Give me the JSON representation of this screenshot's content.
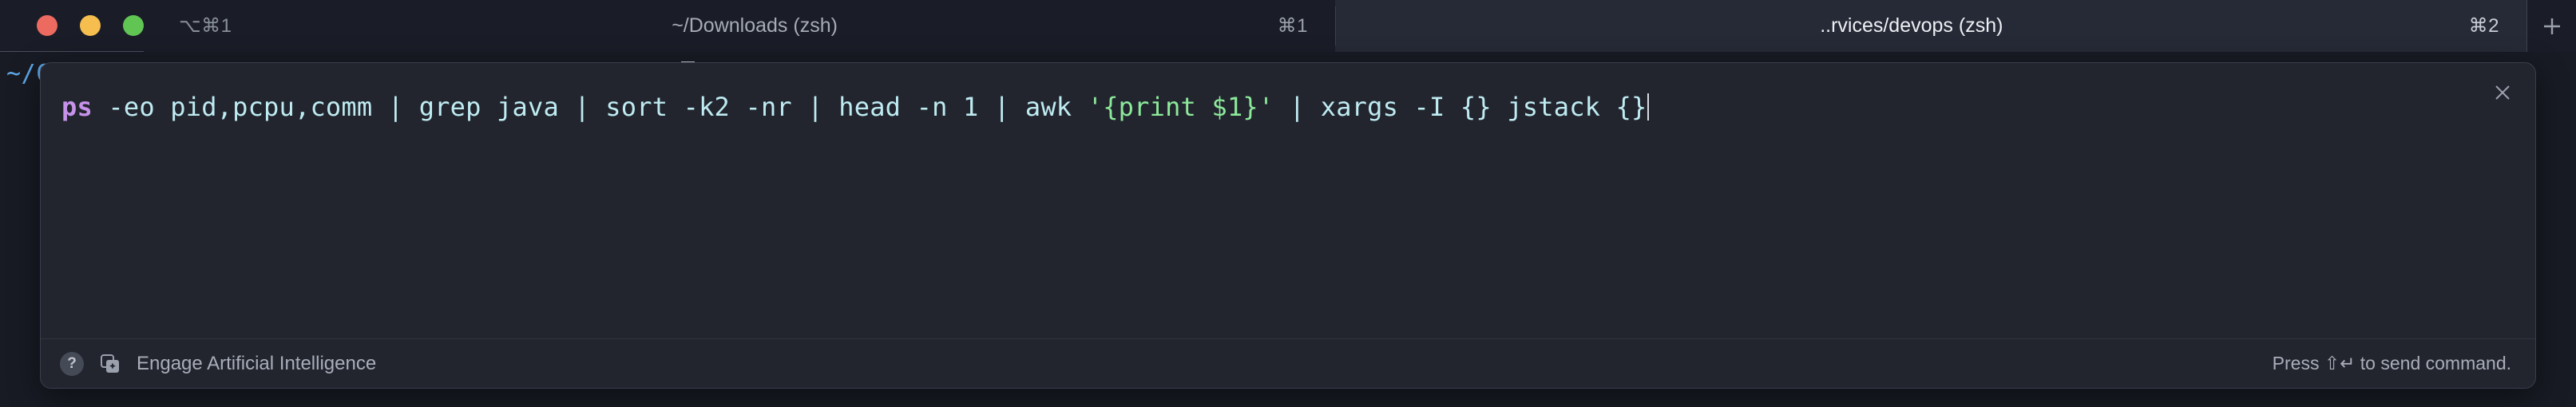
{
  "window": {
    "traffic_lights": [
      {
        "name": "close",
        "color": "#EC6A5F"
      },
      {
        "name": "minimize",
        "color": "#F5BE4F"
      },
      {
        "name": "maximize",
        "color": "#61C554"
      }
    ],
    "window_shortcut": "⌥⌘1"
  },
  "tabs": [
    {
      "title": "~/Downloads (zsh)",
      "shortcut": "⌘1",
      "active": false
    },
    {
      "title": "..rvices/devops (zsh)",
      "shortcut": "⌘2",
      "active": true
    }
  ],
  "new_tab": {
    "label": "+",
    "icon": "plus-icon"
  },
  "terminal": {
    "prompt_path": "~/Code/Dev…/Engine/services/devops on main",
    "prompt_arrow": "❯"
  },
  "overlay": {
    "close_icon": "close-icon",
    "command_text": "ps -eo pid,pcpu,comm | grep java | sort -k2 -nr | head -n 1 | awk '{print $1}' | xargs -I {} jstack {}",
    "command_tokens": [
      {
        "text": "ps",
        "type": "command"
      },
      {
        "text": " -eo pid,pcpu,comm | grep java | sort -k2 -nr | head -n 1 | awk ",
        "type": "text"
      },
      {
        "text": "'{print $1}'",
        "type": "string"
      },
      {
        "text": " | xargs -I {} jstack {}",
        "type": "text"
      }
    ],
    "footer": {
      "help_label": "?",
      "ai_icon": "ai-sparkle-icon",
      "ai_label": "Engage Artificial Intelligence",
      "hint": "Press ⇧↵ to send command."
    }
  },
  "colors": {
    "background": "#181B24",
    "tabbar_inactive": "#1A1D27",
    "tabbar_active": "#262A36",
    "overlay_bg": "#22252E",
    "accent_command": "#C792EA",
    "accent_string": "#8CE99A",
    "accent_text": "#BFEBF2",
    "prompt_blue": "#5FA8E8"
  }
}
